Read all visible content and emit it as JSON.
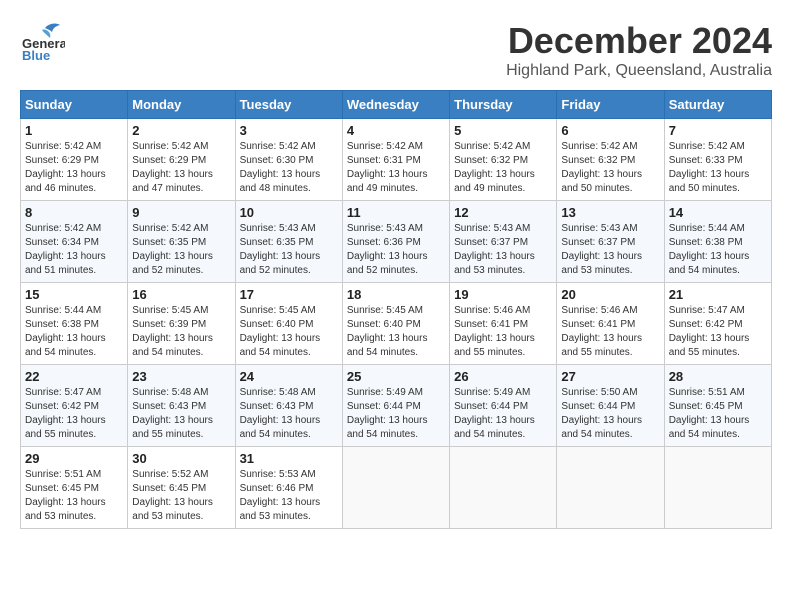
{
  "header": {
    "logo_general": "General",
    "logo_blue": "Blue",
    "title": "December 2024",
    "subtitle": "Highland Park, Queensland, Australia"
  },
  "calendar": {
    "weekdays": [
      "Sunday",
      "Monday",
      "Tuesday",
      "Wednesday",
      "Thursday",
      "Friday",
      "Saturday"
    ],
    "weeks": [
      [
        {
          "day": "1",
          "sunrise": "5:42 AM",
          "sunset": "6:29 PM",
          "daylight": "13 hours and 46 minutes."
        },
        {
          "day": "2",
          "sunrise": "5:42 AM",
          "sunset": "6:29 PM",
          "daylight": "13 hours and 47 minutes."
        },
        {
          "day": "3",
          "sunrise": "5:42 AM",
          "sunset": "6:30 PM",
          "daylight": "13 hours and 48 minutes."
        },
        {
          "day": "4",
          "sunrise": "5:42 AM",
          "sunset": "6:31 PM",
          "daylight": "13 hours and 49 minutes."
        },
        {
          "day": "5",
          "sunrise": "5:42 AM",
          "sunset": "6:32 PM",
          "daylight": "13 hours and 49 minutes."
        },
        {
          "day": "6",
          "sunrise": "5:42 AM",
          "sunset": "6:32 PM",
          "daylight": "13 hours and 50 minutes."
        },
        {
          "day": "7",
          "sunrise": "5:42 AM",
          "sunset": "6:33 PM",
          "daylight": "13 hours and 50 minutes."
        }
      ],
      [
        {
          "day": "8",
          "sunrise": "5:42 AM",
          "sunset": "6:34 PM",
          "daylight": "13 hours and 51 minutes."
        },
        {
          "day": "9",
          "sunrise": "5:42 AM",
          "sunset": "6:35 PM",
          "daylight": "13 hours and 52 minutes."
        },
        {
          "day": "10",
          "sunrise": "5:43 AM",
          "sunset": "6:35 PM",
          "daylight": "13 hours and 52 minutes."
        },
        {
          "day": "11",
          "sunrise": "5:43 AM",
          "sunset": "6:36 PM",
          "daylight": "13 hours and 52 minutes."
        },
        {
          "day": "12",
          "sunrise": "5:43 AM",
          "sunset": "6:37 PM",
          "daylight": "13 hours and 53 minutes."
        },
        {
          "day": "13",
          "sunrise": "5:43 AM",
          "sunset": "6:37 PM",
          "daylight": "13 hours and 53 minutes."
        },
        {
          "day": "14",
          "sunrise": "5:44 AM",
          "sunset": "6:38 PM",
          "daylight": "13 hours and 54 minutes."
        }
      ],
      [
        {
          "day": "15",
          "sunrise": "5:44 AM",
          "sunset": "6:38 PM",
          "daylight": "13 hours and 54 minutes."
        },
        {
          "day": "16",
          "sunrise": "5:45 AM",
          "sunset": "6:39 PM",
          "daylight": "13 hours and 54 minutes."
        },
        {
          "day": "17",
          "sunrise": "5:45 AM",
          "sunset": "6:40 PM",
          "daylight": "13 hours and 54 minutes."
        },
        {
          "day": "18",
          "sunrise": "5:45 AM",
          "sunset": "6:40 PM",
          "daylight": "13 hours and 54 minutes."
        },
        {
          "day": "19",
          "sunrise": "5:46 AM",
          "sunset": "6:41 PM",
          "daylight": "13 hours and 55 minutes."
        },
        {
          "day": "20",
          "sunrise": "5:46 AM",
          "sunset": "6:41 PM",
          "daylight": "13 hours and 55 minutes."
        },
        {
          "day": "21",
          "sunrise": "5:47 AM",
          "sunset": "6:42 PM",
          "daylight": "13 hours and 55 minutes."
        }
      ],
      [
        {
          "day": "22",
          "sunrise": "5:47 AM",
          "sunset": "6:42 PM",
          "daylight": "13 hours and 55 minutes."
        },
        {
          "day": "23",
          "sunrise": "5:48 AM",
          "sunset": "6:43 PM",
          "daylight": "13 hours and 55 minutes."
        },
        {
          "day": "24",
          "sunrise": "5:48 AM",
          "sunset": "6:43 PM",
          "daylight": "13 hours and 54 minutes."
        },
        {
          "day": "25",
          "sunrise": "5:49 AM",
          "sunset": "6:44 PM",
          "daylight": "13 hours and 54 minutes."
        },
        {
          "day": "26",
          "sunrise": "5:49 AM",
          "sunset": "6:44 PM",
          "daylight": "13 hours and 54 minutes."
        },
        {
          "day": "27",
          "sunrise": "5:50 AM",
          "sunset": "6:44 PM",
          "daylight": "13 hours and 54 minutes."
        },
        {
          "day": "28",
          "sunrise": "5:51 AM",
          "sunset": "6:45 PM",
          "daylight": "13 hours and 54 minutes."
        }
      ],
      [
        {
          "day": "29",
          "sunrise": "5:51 AM",
          "sunset": "6:45 PM",
          "daylight": "13 hours and 53 minutes."
        },
        {
          "day": "30",
          "sunrise": "5:52 AM",
          "sunset": "6:45 PM",
          "daylight": "13 hours and 53 minutes."
        },
        {
          "day": "31",
          "sunrise": "5:53 AM",
          "sunset": "6:46 PM",
          "daylight": "13 hours and 53 minutes."
        },
        null,
        null,
        null,
        null
      ]
    ]
  }
}
